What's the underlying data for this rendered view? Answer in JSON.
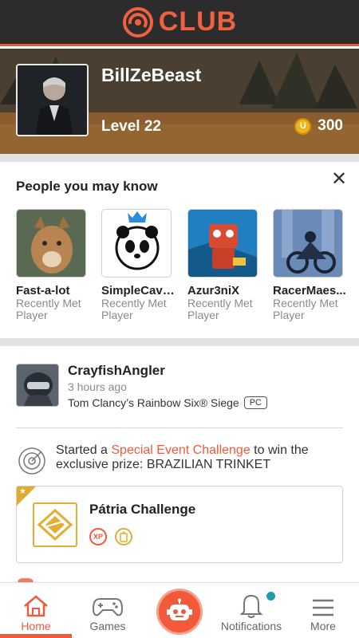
{
  "header": {
    "logo_text": "CLUB",
    "logo_icon": "swirl-icon",
    "accent": "#f2613f"
  },
  "profile": {
    "username": "BillZeBeast",
    "level": "Level 22",
    "coins": "300",
    "coin_icon": "coin-icon"
  },
  "people": {
    "title": "People you may know",
    "items": [
      {
        "name": "Fast-a-lot",
        "subtitle": "Recently Met Player"
      },
      {
        "name": "SimpleCavi...",
        "subtitle": "Recently Met Player"
      },
      {
        "name": "Azur3niX",
        "subtitle": "Recently Met Player"
      },
      {
        "name": "RacerMaes...",
        "subtitle": "Recently Met Player"
      }
    ]
  },
  "feed": {
    "user": "CrayfishAngler",
    "time": "3 hours ago",
    "game": "Tom Clancy’s Rainbow Six® Siege",
    "platform": "PC",
    "activity_prefix": "Started a ",
    "activity_highlight": "Special Event Challenge",
    "activity_suffix": " to win the exclusive prize: BRAZILIAN TRINKET",
    "challenge_title": "Pátria Challenge",
    "reward_xp": "XP"
  },
  "nav": {
    "items": [
      {
        "label": "Home",
        "icon": "home-icon",
        "active": true
      },
      {
        "label": "Games",
        "icon": "gamepad-icon"
      },
      {
        "label": "",
        "icon": "robot-icon"
      },
      {
        "label": "Notifications",
        "icon": "bell-icon"
      },
      {
        "label": "More",
        "icon": "menu-icon"
      }
    ]
  }
}
